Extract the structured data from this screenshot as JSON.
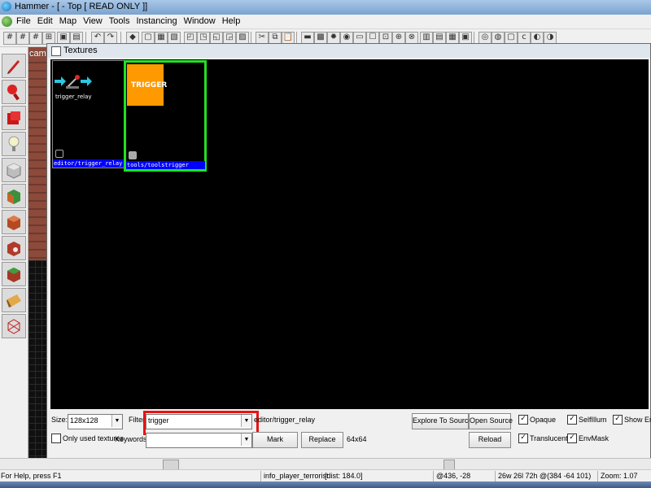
{
  "window": {
    "title": "Hammer - [ - Top [ READ ONLY ]]"
  },
  "menu": {
    "items": [
      "File",
      "Edit",
      "Map",
      "View",
      "Tools",
      "Instancing",
      "Window",
      "Help"
    ]
  },
  "viewports": {
    "camera_label": "came"
  },
  "textures_window": {
    "title": "Textures",
    "textures": [
      {
        "name": "editor/trigger_relay",
        "label": "trigger_relay",
        "selected": false
      },
      {
        "name": "tools/toolstrigger",
        "label": "TRIGGER",
        "selected": true,
        "swatch_color": "#ff9900"
      }
    ],
    "controls": {
      "size_label": "Size:",
      "size_value": "128x128",
      "filter_label": "Filter:",
      "filter_value": "trigger",
      "current_texture": "editor/trigger_relay",
      "only_used_label": "Only used textures",
      "keywords_label": "Keywords:",
      "keywords_value": "",
      "mark_button": "Mark",
      "replace_button": "Replace",
      "dimensions": "64x64",
      "explore_button": "Explore To Source",
      "open_source_button": "Open Source",
      "reload_button": "Reload",
      "opaque_label": "Opaque",
      "selfillum_label": "SelfIllum",
      "show_errors_label": "Show Erro",
      "translucent_label": "Translucent",
      "envmask_label": "EnvMask",
      "checkbox_mark": "✓"
    },
    "accent_colors": {
      "selection_border": "#22e022",
      "caption_bar": "#0000ff",
      "filter_highlight": "#e81313"
    }
  },
  "statusbar": {
    "help": "For Help, press F1",
    "selection": "info_player_terrorist",
    "distance": "[dist: 184.0]",
    "cursor": "@436, -28",
    "size": "26w 26l 72h @(384 -64 101)",
    "zoom": "Zoom: 1.07"
  }
}
